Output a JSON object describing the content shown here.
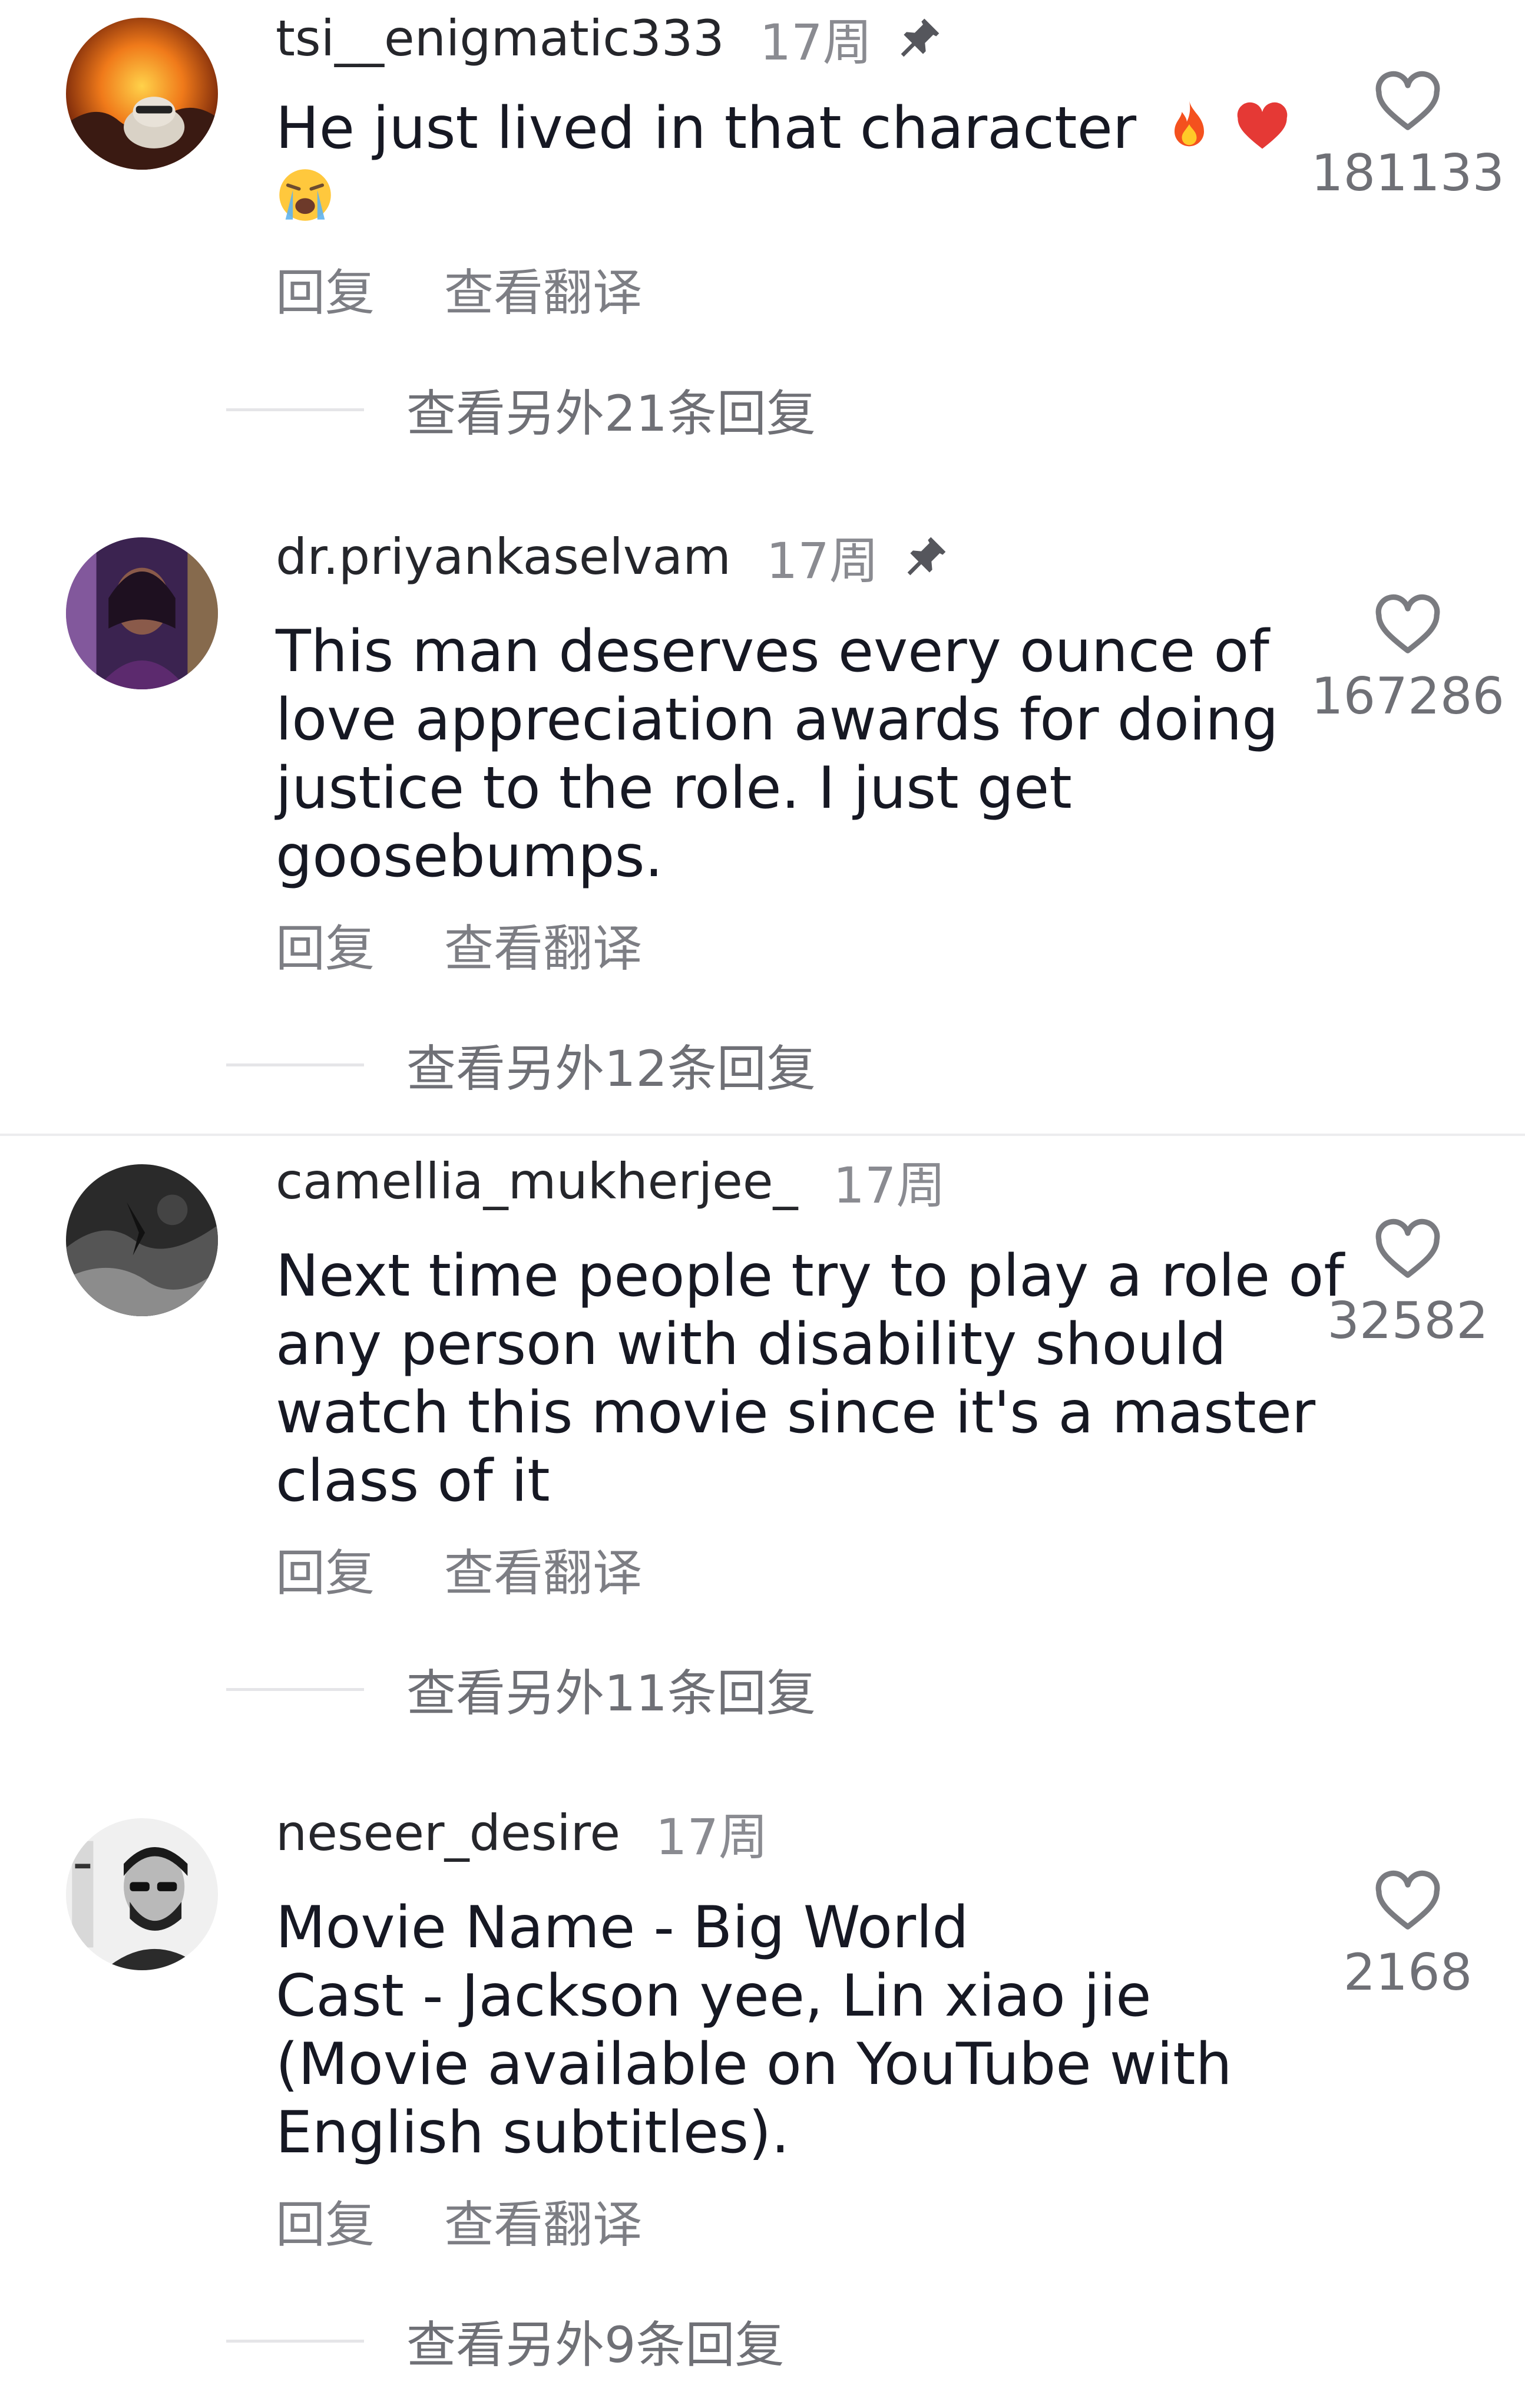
{
  "comments": [
    {
      "username": "tsi__enigmatic333",
      "time": "17周",
      "pinned": true,
      "lines": [
        "He just lived in that character",
        ""
      ],
      "emojis": [
        "fire-emoji",
        "red-heart-emoji",
        "loudly-crying-face-emoji"
      ],
      "likes": "181133",
      "reply_label": "回复",
      "translate_label": "查看翻译",
      "more_replies": "查看另外21条回复"
    },
    {
      "username": "dr.priyankaselvam",
      "time": "17周",
      "pinned": true,
      "lines": [
        "This man deserves every ounce of",
        "love appreciation awards for doing",
        "justice to the role. I just get",
        "goosebumps."
      ],
      "likes": "167286",
      "reply_label": "回复",
      "translate_label": "查看翻译",
      "more_replies": "查看另外12条回复"
    },
    {
      "username": "camellia_mukherjee_",
      "time": "17周",
      "pinned": false,
      "lines": [
        "Next time people try to play a role of",
        "any person with disability should",
        "watch this movie since it's a master",
        "class of it"
      ],
      "likes": "32582",
      "reply_label": "回复",
      "translate_label": "查看翻译",
      "more_replies": "查看另外11条回复"
    },
    {
      "username": "neseer_desire",
      "time": "17周",
      "pinned": false,
      "lines": [
        "Movie Name - Big World",
        "Cast - Jackson yee, Lin xiao jie",
        "(Movie available on YouTube with",
        "English subtitles)."
      ],
      "likes": "2168",
      "reply_label": "回复",
      "translate_label": "查看翻译",
      "more_replies": "查看另外9条回复"
    }
  ],
  "icons": {
    "like": "heart-outline-icon",
    "pin": "pin-icon"
  },
  "colors": {
    "username": "#25262b",
    "meta": "#8a8b91",
    "body": "#161823",
    "divider": "#ececee"
  }
}
